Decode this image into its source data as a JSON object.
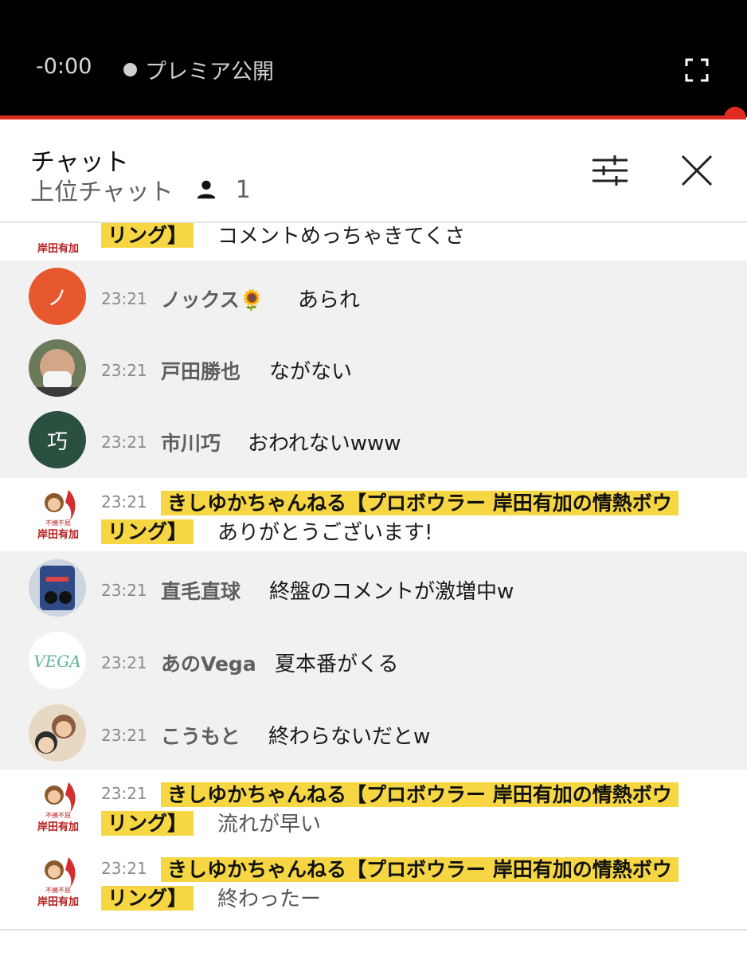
{
  "player": {
    "time": "-0:00",
    "premiere_label": "プレミア公開"
  },
  "chat_header": {
    "title": "チャット",
    "mode": "上位チャット",
    "viewers": "1"
  },
  "owner_name_line1": "きしゆかちゃんねる【プロボウラー 岸田有加の情熱ボウ",
  "owner_name_line2": "リング】",
  "messages": [
    {
      "type": "owner",
      "time": "",
      "text": "コメントめっちゃきてくさ"
    },
    {
      "type": "user",
      "time": "23:21",
      "author": "ノックス🌻",
      "text": "あられ",
      "avatar": {
        "kind": "letter",
        "letter": "ノ",
        "color": "#e8582e"
      }
    },
    {
      "type": "user",
      "time": "23:21",
      "author": "戸田勝也",
      "text": "ながない",
      "avatar": {
        "kind": "photo",
        "color": "#c9a27e"
      }
    },
    {
      "type": "user",
      "time": "23:21",
      "author": "市川巧",
      "text": "おわれないwww",
      "avatar": {
        "kind": "letter",
        "letter": "巧",
        "color": "#2a5040"
      }
    },
    {
      "type": "owner",
      "time": "23:21",
      "text": "ありがとうございます!"
    },
    {
      "type": "user",
      "time": "23:21",
      "author": "直毛直球",
      "text": "終盤のコメントが激増中w",
      "avatar": {
        "kind": "photo",
        "color": "#3b4f7a"
      }
    },
    {
      "type": "user",
      "time": "23:21",
      "author": "あのVega",
      "text": "夏本番がくる",
      "avatar": {
        "kind": "vega",
        "label": "VEGA",
        "color": "#5fb39a"
      }
    },
    {
      "type": "user",
      "time": "23:21",
      "author": "こうもと",
      "text": "終わらないだとw",
      "avatar": {
        "kind": "photo",
        "color": "#a07a60"
      }
    },
    {
      "type": "owner",
      "time": "23:21",
      "text": "流れが早い"
    },
    {
      "type": "owner",
      "time": "23:21",
      "text": "終わったー"
    }
  ],
  "colors": {
    "accent_red": "#e02b20",
    "owner_highlight": "#f6d743",
    "row_gray": "#f1f1f1"
  }
}
